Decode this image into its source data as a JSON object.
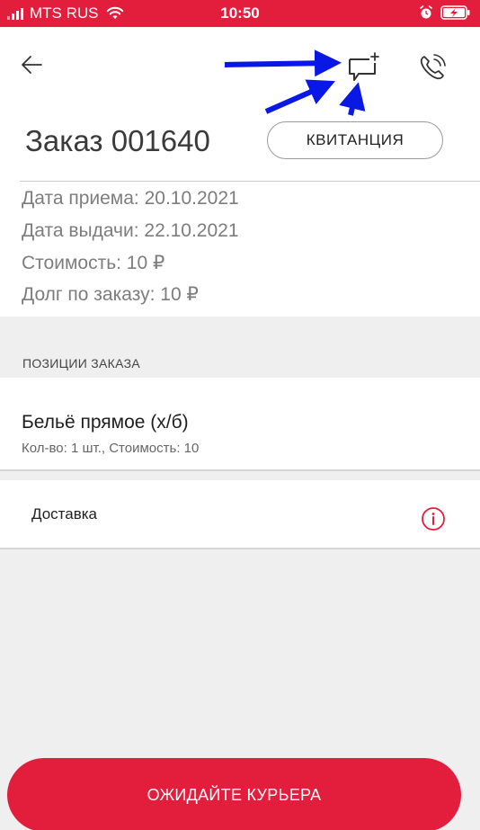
{
  "status_bar": {
    "carrier": "MTS RUS",
    "time": "10:50",
    "background_color": "#e31e3c"
  },
  "header": {
    "back_icon": "back-arrow-icon",
    "comment_icon": "comment-add-icon",
    "phone_icon": "phone-call-icon"
  },
  "order": {
    "title": "Заказ 001640",
    "receipt_button": "КВИТАНЦИЯ",
    "date_received": "Дата приема: 20.10.2021",
    "date_issued": "Дата выдачи: 22.10.2021",
    "cost": "Стоимость: 10 ₽",
    "debt": "Долг по заказу: 10 ₽"
  },
  "positions": {
    "section_title": "ПОЗИЦИИ ЗАКАЗА",
    "items": [
      {
        "name": "Бельё прямое (х/б)",
        "details": "Кол-во: 1 шт., Стоимость: 10"
      }
    ]
  },
  "delivery": {
    "label": "Доставка",
    "info_icon": "info-icon"
  },
  "action": {
    "label": "ОЖИДАЙТЕ КУРЬЕРА",
    "color": "#e31e3c"
  },
  "annotation": {
    "arrow_color": "#0a18e6"
  }
}
